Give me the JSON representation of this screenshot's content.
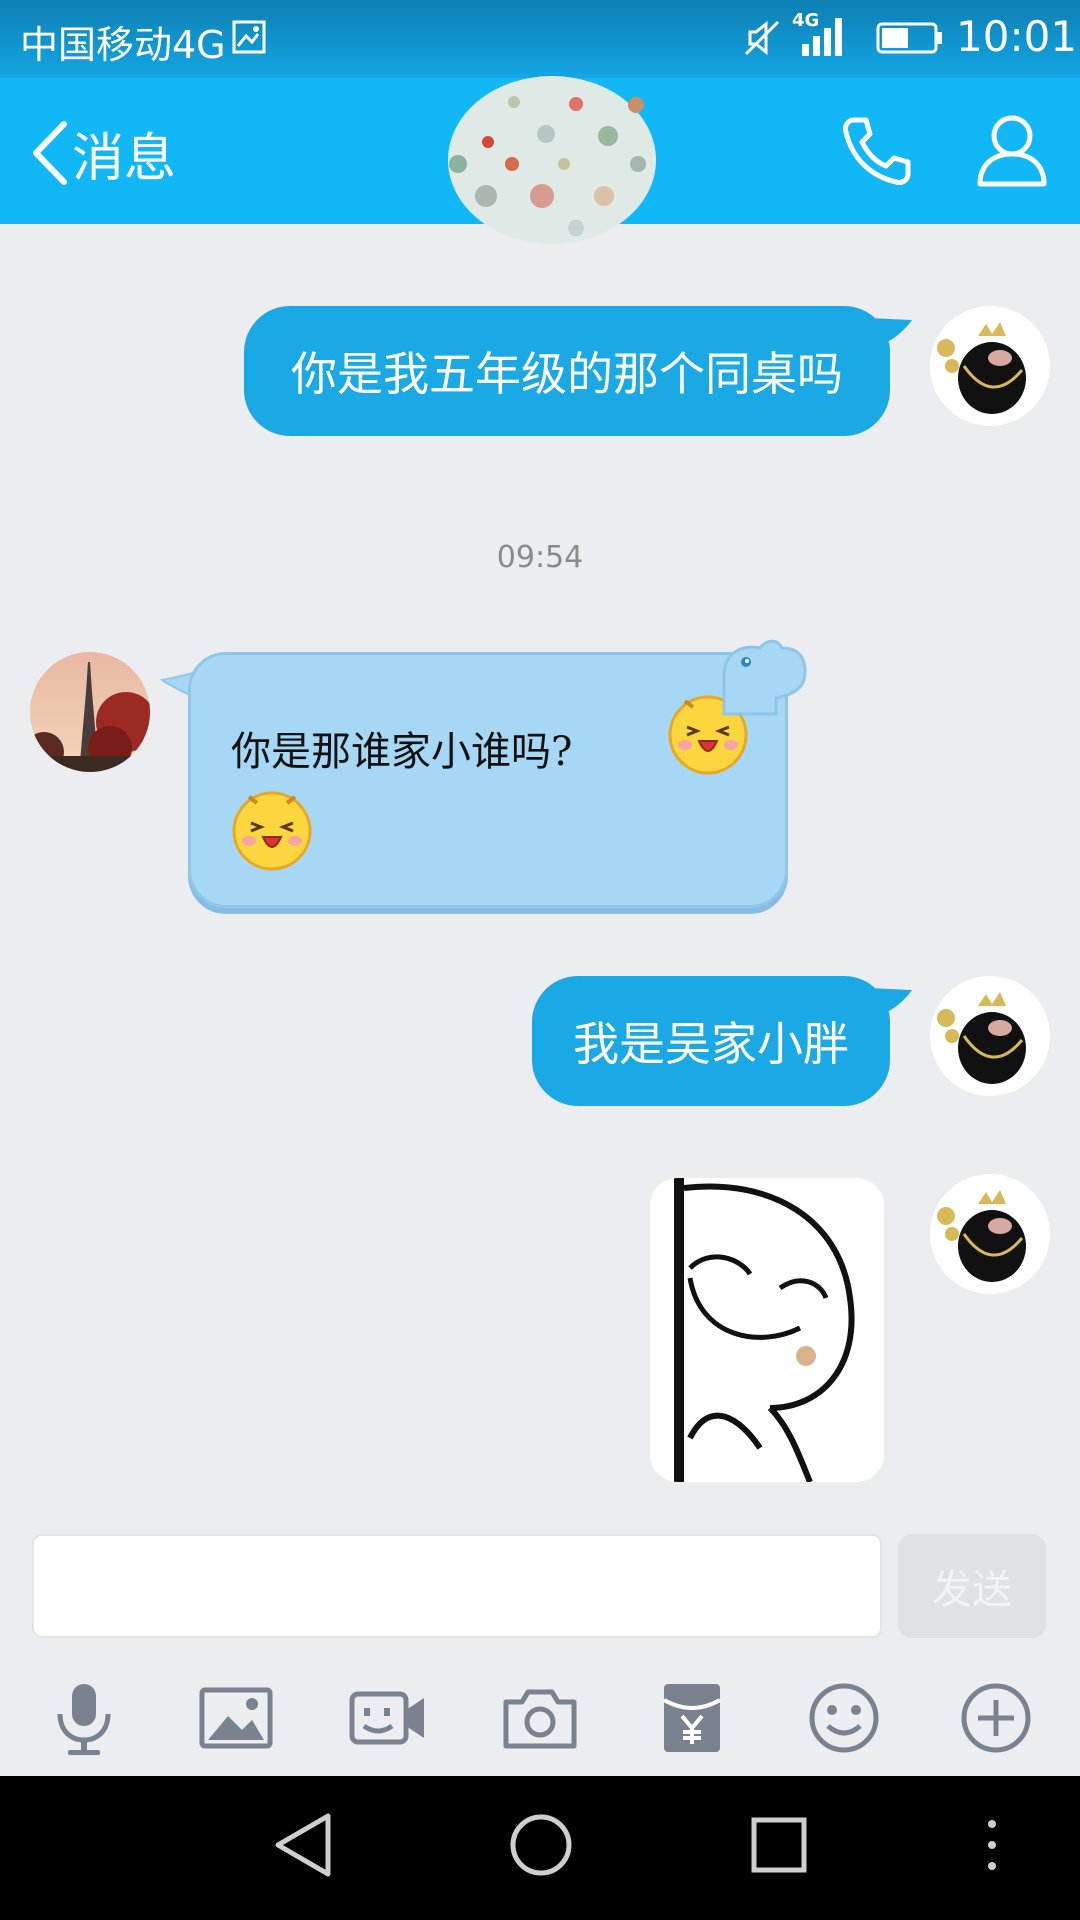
{
  "status_bar": {
    "carrier": "中国移动4G",
    "network_badge": "4G",
    "time": "10:01",
    "icons": [
      "gallery-icon",
      "mute-icon",
      "signal-icon",
      "battery-icon"
    ]
  },
  "header": {
    "back_label": "消息",
    "icons": [
      "back-chevron-icon",
      "group-avatar",
      "phone-icon",
      "person-icon"
    ]
  },
  "messages": [
    {
      "side": "out",
      "text": "你是我五年级的那个同桌吗"
    },
    {
      "type": "timestamp",
      "text": "09:54"
    },
    {
      "side": "in",
      "text": "你是那谁家小谁吗?",
      "emoji": "laughing-face-emoji"
    },
    {
      "side": "out",
      "text": "我是吴家小胖"
    },
    {
      "side": "out",
      "type": "sticker",
      "sticker": "peeking-face-sticker"
    }
  ],
  "composer": {
    "input_value": "",
    "send_label": "发送"
  },
  "toolbar": [
    "microphone-icon",
    "image-icon",
    "video-call-icon",
    "camera-icon",
    "red-packet-icon",
    "emoji-icon",
    "plus-icon"
  ],
  "colors": {
    "header": "#12b7f5",
    "outgoing_bubble": "#1ba9e6",
    "incoming_bubble": "#a6d7f4",
    "background": "#ecedf1"
  }
}
